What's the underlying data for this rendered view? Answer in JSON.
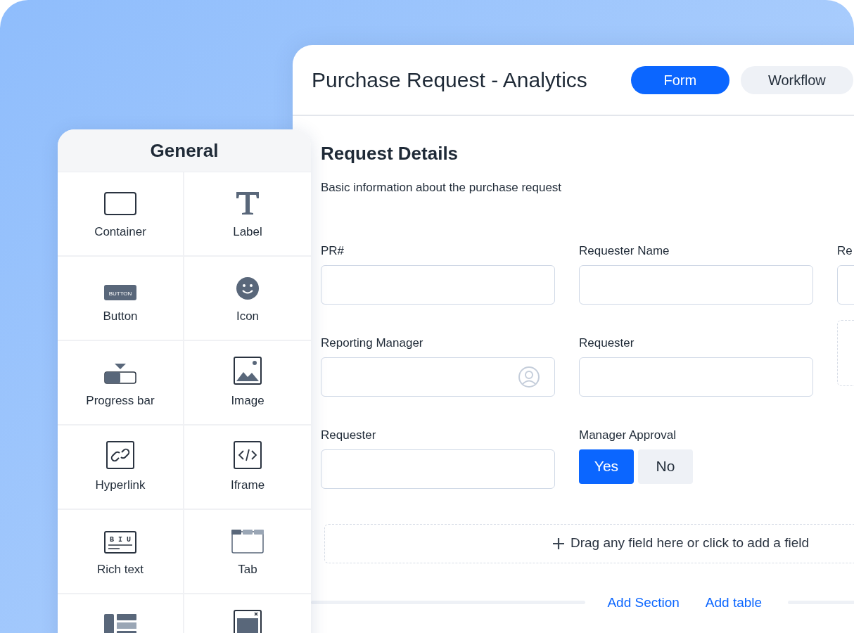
{
  "window": {
    "title": "Purchase Request - Analytics"
  },
  "tabs": [
    {
      "label": "Form",
      "selected": true
    },
    {
      "label": "Workflow",
      "selected": false
    }
  ],
  "palette": {
    "title": "General",
    "items": [
      {
        "kind": "container",
        "label": "Container"
      },
      {
        "kind": "label",
        "label": "Label"
      },
      {
        "kind": "button",
        "label": "Button",
        "icon_text": "BUTTON"
      },
      {
        "kind": "icon",
        "label": "Icon"
      },
      {
        "kind": "progress",
        "label": "Progress bar"
      },
      {
        "kind": "image",
        "label": "Image"
      },
      {
        "kind": "hyperlink",
        "label": "Hyperlink"
      },
      {
        "kind": "iframe",
        "label": "Iframe"
      },
      {
        "kind": "richtext",
        "label": "Rich text",
        "icon_text": "B I U"
      },
      {
        "kind": "tab",
        "label": "Tab"
      },
      {
        "kind": "columns"
      },
      {
        "kind": "modal"
      }
    ]
  },
  "section": {
    "title": "Request Details",
    "description": "Basic information about the purchase request",
    "fields": [
      {
        "kind": "text",
        "label": "PR#"
      },
      {
        "kind": "text",
        "label": "Requester Name"
      },
      {
        "kind": "text",
        "label": "Re"
      },
      {
        "kind": "user",
        "label": "Reporting Manager"
      },
      {
        "kind": "text",
        "label": "Requester"
      },
      {
        "kind": "slot"
      },
      {
        "kind": "text",
        "label": "Requester"
      },
      {
        "kind": "toggle",
        "label": "Manager Approval",
        "options": [
          {
            "label": "Yes",
            "selected": true
          },
          {
            "label": "No",
            "selected": false
          }
        ]
      }
    ]
  },
  "drop_zone": {
    "text": "Drag any field here or click to add a field"
  },
  "actions": [
    "Add Section",
    "Add table"
  ]
}
